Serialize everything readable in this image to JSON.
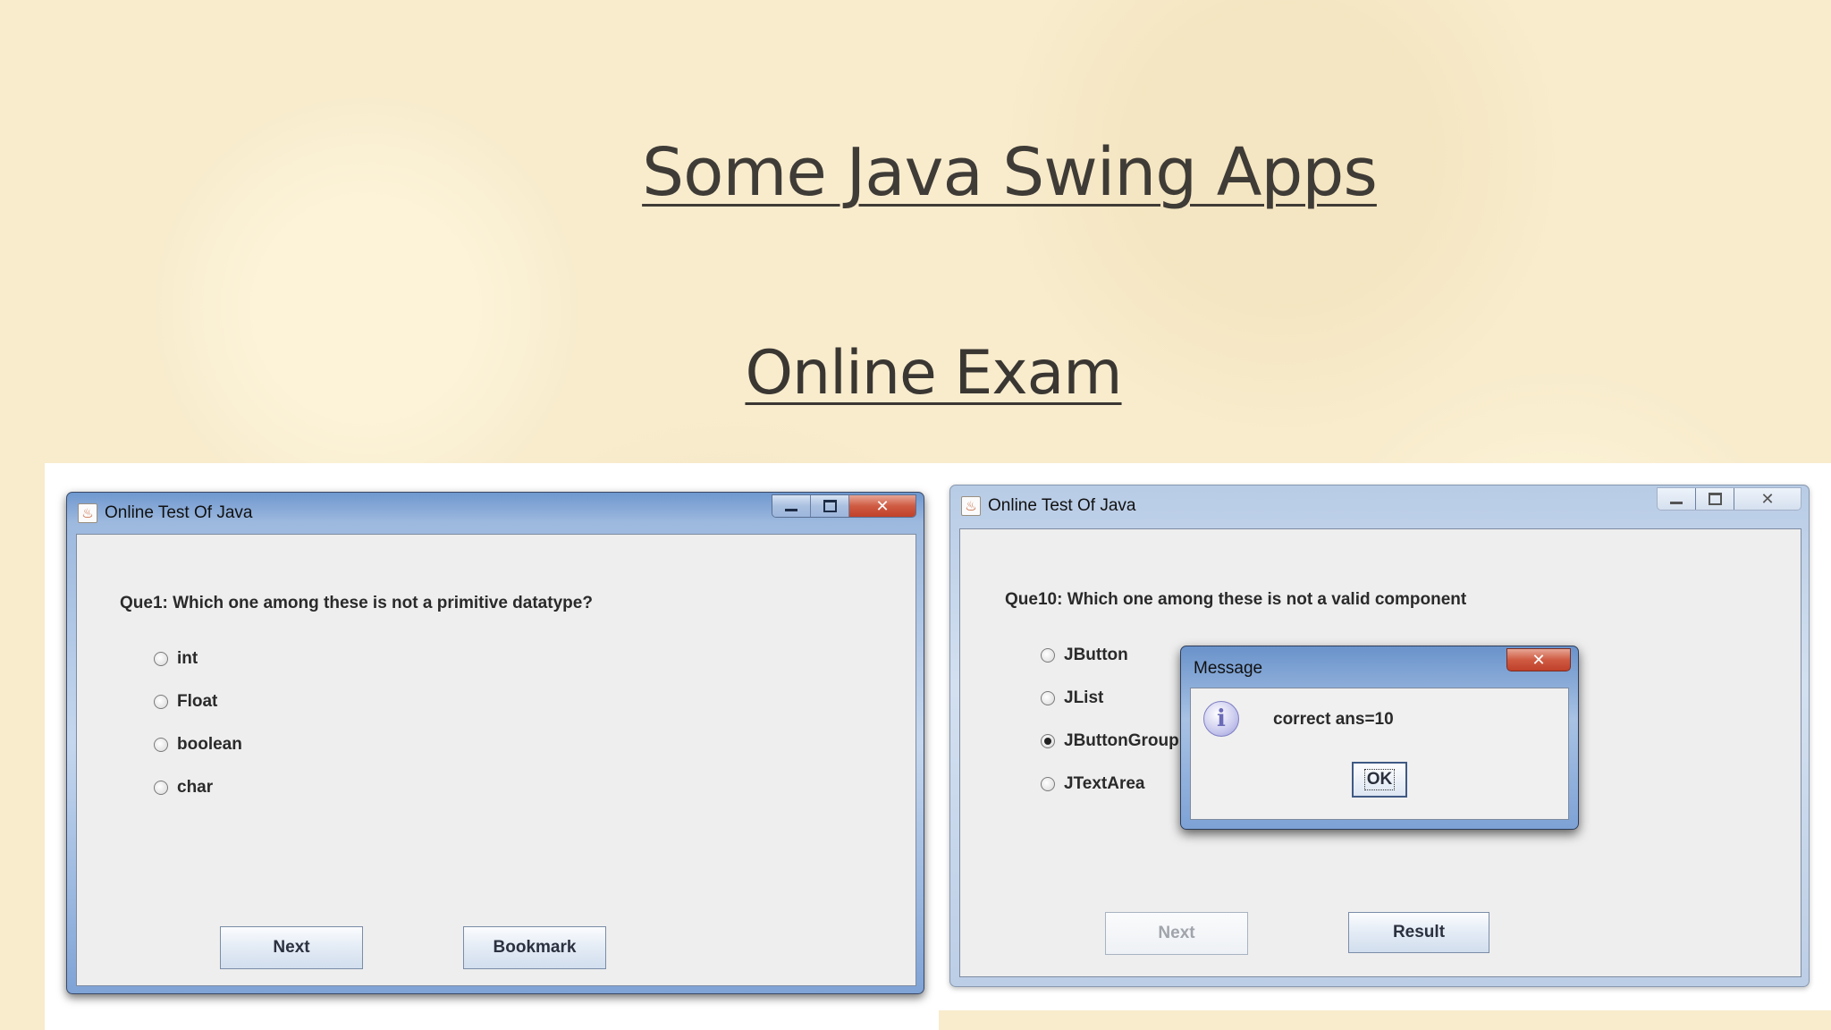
{
  "slide": {
    "title": "Some Java Swing Apps",
    "subtitle": "Online Exam"
  },
  "left_window": {
    "title": "Online Test Of Java",
    "question": "Que1: Which one among these is not a primitive datatype?",
    "options": [
      "int",
      "Float",
      "boolean",
      "char"
    ],
    "buttons": {
      "next": "Next",
      "bookmark": "Bookmark"
    }
  },
  "right_window": {
    "title": "Online Test Of Java",
    "question": "Que10: Which one among these is not a valid component",
    "options": [
      "JButton",
      "JList",
      "JButtonGroup",
      "JTextArea"
    ],
    "selected_option": "JButtonGroup",
    "buttons": {
      "next": "Next",
      "result": "Result"
    },
    "dialog": {
      "title": "Message",
      "message": "correct ans=10",
      "ok_label": "OK"
    }
  },
  "icons": {
    "app": "java-cup-icon",
    "minimize": "minimize-icon",
    "maximize": "maximize-icon",
    "close": "close-icon",
    "info": "info-icon"
  },
  "glyphs": {
    "app": "♨",
    "close": "✕",
    "info": "i"
  },
  "colors": {
    "close_button": "#c9452e",
    "title_gradient": "#6f98cf",
    "client_bg": "#eeeeee",
    "slide_bg": "#f8eccd"
  }
}
